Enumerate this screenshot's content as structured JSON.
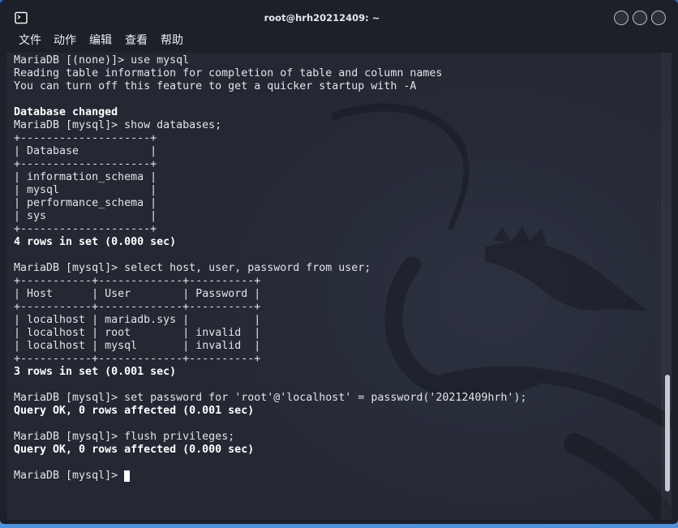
{
  "window": {
    "title": "root@hrh20212409: ~"
  },
  "icons": {
    "app": "terminal-icon"
  },
  "menu": {
    "items": [
      "文件",
      "动作",
      "编辑",
      "查看",
      "帮助"
    ]
  },
  "terminal": {
    "entries": [
      {
        "prompt": "MariaDB [(none)]>",
        "input": "use mysql",
        "messages": [
          "Reading table information for completion of table and column names",
          "You can turn off this feature to get a quicker startup with -A"
        ],
        "status": "Database changed"
      },
      {
        "prompt": "MariaDB [mysql]>",
        "input": "show databases;",
        "table": {
          "columns": [
            "Database"
          ],
          "rows": [
            [
              "information_schema"
            ],
            [
              "mysql"
            ],
            [
              "performance_schema"
            ],
            [
              "sys"
            ]
          ]
        },
        "status": "4 rows in set (0.000 sec)"
      },
      {
        "prompt": "MariaDB [mysql]>",
        "input": "select host, user, password from user;",
        "table": {
          "columns": [
            "Host",
            "User",
            "Password"
          ],
          "rows": [
            [
              "localhost",
              "mariadb.sys",
              ""
            ],
            [
              "localhost",
              "root",
              "invalid"
            ],
            [
              "localhost",
              "mysql",
              "invalid"
            ]
          ]
        },
        "status": "3 rows in set (0.001 sec)"
      },
      {
        "prompt": "MariaDB [mysql]>",
        "input": "set password for 'root'@'localhost' = password('20212409hrh');",
        "status": "Query OK, 0 rows affected (0.001 sec)"
      },
      {
        "prompt": "MariaDB [mysql]>",
        "input": "flush privileges;",
        "status": "Query OK, 0 rows affected (0.000 sec)"
      }
    ],
    "current_prompt": "MariaDB [mysql]>"
  },
  "scrollbar": {
    "scroll_position": 0.92,
    "visible_fraction": 0.25
  },
  "theme": {
    "foreground": "#e4e4e4",
    "bold_foreground": "#ffffff",
    "background": "#242833",
    "chrome": "#1d2028"
  }
}
